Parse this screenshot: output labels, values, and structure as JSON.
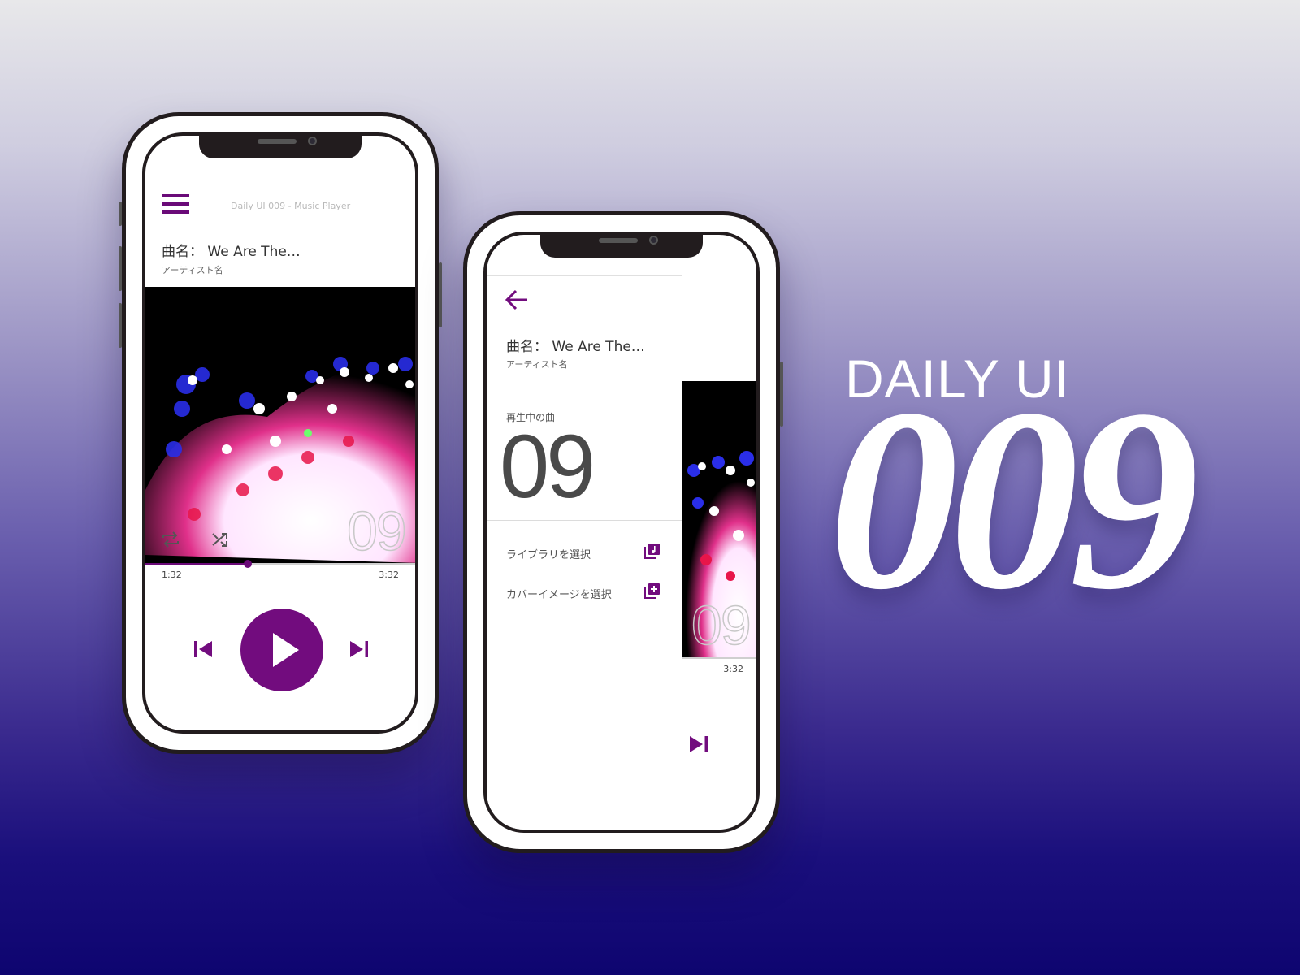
{
  "hero": {
    "daily_label": "DAILY UI",
    "number": "009"
  },
  "phone1": {
    "app_title": "Daily UI 009 - Music Player",
    "song": "曲名： We Are The…",
    "artist": "アーティスト名",
    "art_overlay": "09",
    "progress": 0.37,
    "time_current": "1:32",
    "time_total": "3:32"
  },
  "phone2": {
    "song": "曲名： We Are The…",
    "artist": "アーティスト名",
    "now_playing_label": "再生中の曲",
    "now_playing_number": "09",
    "menu": [
      {
        "label": "ライブラリを選択",
        "icon": "library-music-icon"
      },
      {
        "label": "カバーイメージを選択",
        "icon": "library-add-icon"
      }
    ],
    "art_overlay": "09",
    "time_total": "3:32"
  },
  "colors": {
    "accent": "#720c7e",
    "bg_top": "#e8e8ea",
    "bg_bottom": "#0e0570"
  }
}
